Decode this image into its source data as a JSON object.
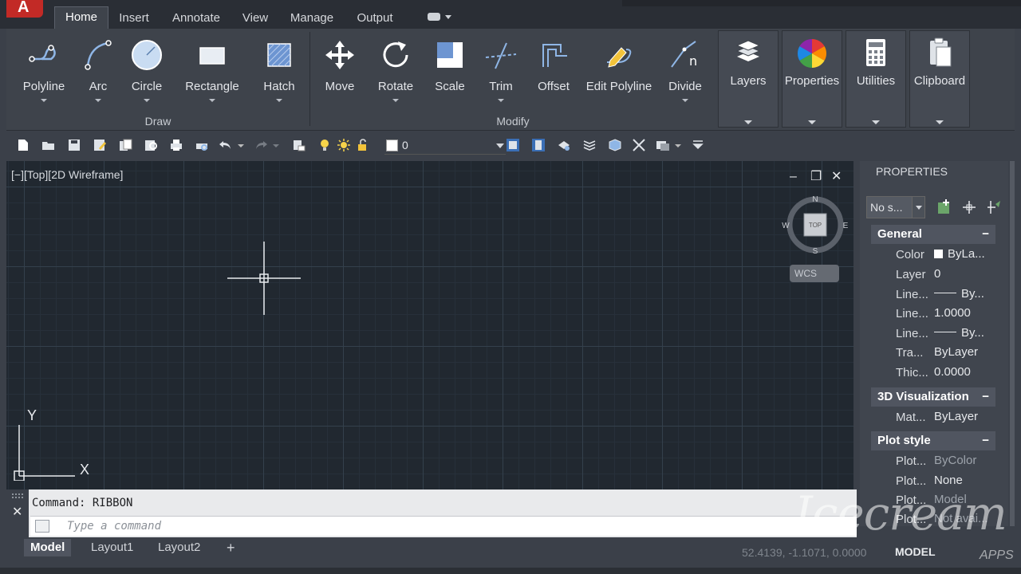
{
  "tabs": [
    "Home",
    "Insert",
    "Annotate",
    "View",
    "Manage",
    "Output"
  ],
  "draw_panel": {
    "label": "Draw",
    "tools": [
      "Polyline",
      "Arc",
      "Circle",
      "Rectangle",
      "Hatch"
    ]
  },
  "modify_panel": {
    "label": "Modify",
    "tools": [
      "Move",
      "Rotate",
      "Scale",
      "Trim",
      "Offset",
      "Edit Polyline",
      "Divide"
    ]
  },
  "big_panels": [
    "Layers",
    "Properties",
    "Utilities",
    "Clipboard"
  ],
  "toolbar": {
    "layer_value": "0"
  },
  "viewport": {
    "label": "[−][Top][2D Wireframe]",
    "controls": {
      "minimize": "–",
      "restore": "❐",
      "close": "✕"
    },
    "viewcube": {
      "n": "N",
      "s": "S",
      "e": "E",
      "w": "W",
      "face": "TOP"
    },
    "wcs": "WCS",
    "ucs": {
      "x": "X",
      "y": "Y"
    }
  },
  "properties": {
    "title": "PROPERTIES",
    "selection": "No s...",
    "sections": [
      {
        "name": "General",
        "toggle": "−"
      },
      {
        "name": "3D Visualization",
        "toggle": "−"
      },
      {
        "name": "Plot style",
        "toggle": "−"
      }
    ],
    "general": [
      {
        "key": "Color",
        "value": "ByLa..."
      },
      {
        "key": "Layer",
        "value": "0"
      },
      {
        "key": "Line...",
        "value": "By..."
      },
      {
        "key": "Line...",
        "value": "1.0000"
      },
      {
        "key": "Line...",
        "value": "By..."
      },
      {
        "key": "Tra...",
        "value": "ByLayer"
      },
      {
        "key": "Thic...",
        "value": "0.0000"
      }
    ],
    "viz": [
      {
        "key": "Mat...",
        "value": "ByLayer"
      }
    ],
    "plot": [
      {
        "key": "Plot...",
        "value": "ByColor"
      },
      {
        "key": "Plot...",
        "value": "None"
      },
      {
        "key": "Plot...",
        "value": "Model"
      },
      {
        "key": "Plot...",
        "value": "Not avai..."
      }
    ]
  },
  "command": {
    "history": "Command: RIBBON",
    "placeholder": "Type a command",
    "close": "✕"
  },
  "layout_tabs": [
    "Model",
    "Layout1",
    "Layout2",
    "+"
  ],
  "status": {
    "coords": "52.4139, -1.1071, 0.0000",
    "mode": "MODEL"
  },
  "watermark": {
    "text": "Icecream",
    "sub": "APPS"
  },
  "colors": {
    "accent_red": "#c22a26",
    "canvas": "#212830",
    "ribbon": "#3e434b"
  }
}
